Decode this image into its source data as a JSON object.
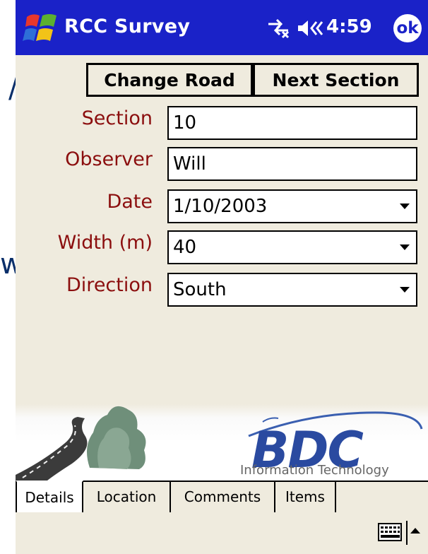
{
  "background": {
    "slash": "/",
    "partial_word": "wn"
  },
  "titlebar": {
    "title": "RCC Survey",
    "time": "4:59",
    "ok_label": "ok"
  },
  "buttons": {
    "change_road": "Change Road",
    "next_section": "Next Section"
  },
  "form": {
    "section": {
      "label": "Section",
      "value": "10"
    },
    "observer": {
      "label": "Observer",
      "value": "Will"
    },
    "date": {
      "label": "Date",
      "value": "1/10/2003"
    },
    "width": {
      "label": "Width (m)",
      "value": "40"
    },
    "direction": {
      "label": "Direction",
      "value": "South"
    }
  },
  "logo": {
    "brand": "BDC",
    "tagline": "Information Technology"
  },
  "tabs": [
    "Details",
    "Location",
    "Comments",
    "Items"
  ],
  "colors": {
    "titlebar": "#1a22c8",
    "form_label": "#8b0e0e",
    "panel": "#efebde",
    "logo_blue": "#2a4aa0"
  }
}
